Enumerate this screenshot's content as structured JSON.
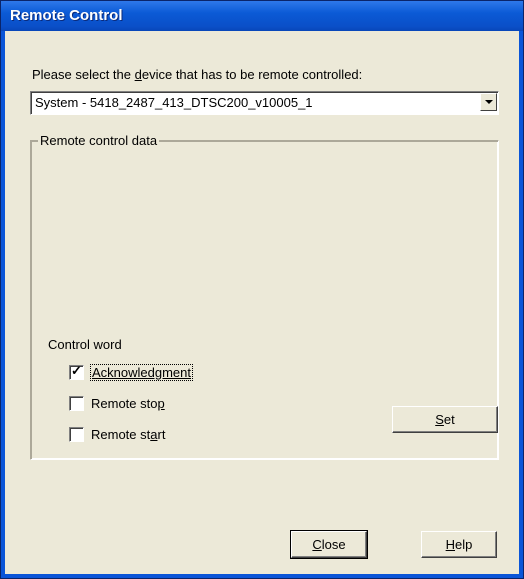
{
  "window": {
    "title": "Remote Control"
  },
  "device": {
    "prompt_pre": "Please select the ",
    "prompt_accel": "d",
    "prompt_post": "evice that has to be remote controlled:",
    "selected": "System - 5418_2487_413_DTSC200_v10005_1"
  },
  "group": {
    "legend": "Remote control data"
  },
  "control_word": {
    "label": "Control word",
    "items": [
      {
        "label": "Acknowledgment",
        "checked": true
      },
      {
        "pre": "Remote sto",
        "accel": "p",
        "post": "",
        "checked": false
      },
      {
        "pre": "Remote st",
        "accel": "a",
        "post": "rt",
        "checked": false
      }
    ]
  },
  "buttons": {
    "set": {
      "accel": "S",
      "rest": "et"
    },
    "close": {
      "accel": "C",
      "rest": "lose"
    },
    "help": {
      "accel": "H",
      "rest": "elp"
    }
  }
}
